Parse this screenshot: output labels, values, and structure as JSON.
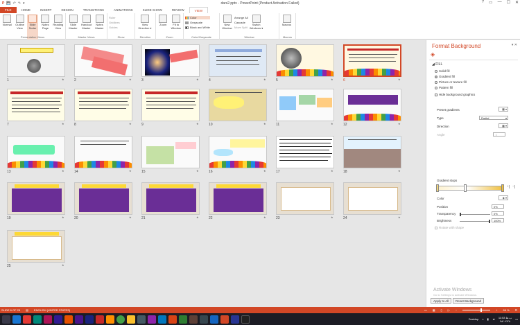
{
  "window": {
    "title": "dars2.pptx - PowerPoint (Product Activation Failed)",
    "controls": [
      "?",
      "▭",
      "—",
      "☐",
      "✕"
    ]
  },
  "qat": [
    "💾",
    "↶",
    "↷",
    "▾"
  ],
  "tabs": [
    "FILE",
    "HOME",
    "INSERT",
    "DESIGN",
    "TRANSITIONS",
    "ANIMATIONS",
    "SLIDE SHOW",
    "REVIEW",
    "VIEW"
  ],
  "active_tab": "VIEW",
  "ribbon": {
    "presentation_views": {
      "label": "Presentation Views",
      "buttons": [
        "Normal",
        "Outline View",
        "Slide Sorter",
        "Notes Page",
        "Reading View"
      ]
    },
    "master_views": {
      "label": "Master Views",
      "buttons": [
        "Slide Master",
        "Handout Master",
        "Notes Master"
      ]
    },
    "show": {
      "label": "Show",
      "items": [
        "Ruler",
        "Gridlines",
        "Guides"
      ]
    },
    "direction": {
      "label": "Direction",
      "button": "View Direction ▾"
    },
    "zoom": {
      "label": "Zoom",
      "buttons": [
        "Zoom",
        "Fit to Window"
      ]
    },
    "color": {
      "label": "Color/Grayscale",
      "items": [
        "Color",
        "Grayscale",
        "Black and White"
      ]
    },
    "window": {
      "label": "Window",
      "new": "New Window",
      "items": [
        "Arrange All",
        "Cascade",
        "Move Split"
      ],
      "switch": "Switch Windows ▾"
    },
    "macros": {
      "label": "Macros",
      "button": "Macros"
    }
  },
  "slides": [
    "1",
    "2",
    "3",
    "4",
    "5",
    "6",
    "7",
    "8",
    "9",
    "10",
    "11",
    "12",
    "13",
    "14",
    "15",
    "16",
    "17",
    "18",
    "19",
    "20",
    "21",
    "22",
    "23",
    "24",
    "25"
  ],
  "selected_slide": "6",
  "format_pane": {
    "title": "Format Background",
    "section": "FILL",
    "fill_options": [
      "Solid fill",
      "Gradient fill",
      "Picture or texture fill",
      "Pattern fill"
    ],
    "selected_fill": "Gradient fill",
    "hide_graphics": "Hide background graphics",
    "preset_label": "Preset gradients",
    "type_label": "Type",
    "type_value": "Radial",
    "direction_label": "Direction",
    "angle_label": "Angle",
    "stops_label": "Gradient stops",
    "color_label": "Color",
    "position_label": "Position",
    "position_value": "0%",
    "transparency_label": "Transparency",
    "transparency_value": "0%",
    "brightness_label": "Brightness",
    "brightness_value": "100%",
    "rotate_label": "Rotate with shape",
    "apply_all": "Apply to All",
    "reset": "Reset Background",
    "watermark": "Activate Windows",
    "watermark_sub": "Go to Settings to activate Windows."
  },
  "status": {
    "slide": "SLIDE 6 OF 25",
    "language": "ENGLISH (UNITED STATES)",
    "zoom": "66 %"
  },
  "taskbar": {
    "desktop": "Desktop",
    "time": "11:53 ب.ظ",
    "date": "۹۸/۰۲/۲۸"
  },
  "colors": {
    "accent": "#d24726",
    "taskbar": "#1c1c24"
  }
}
